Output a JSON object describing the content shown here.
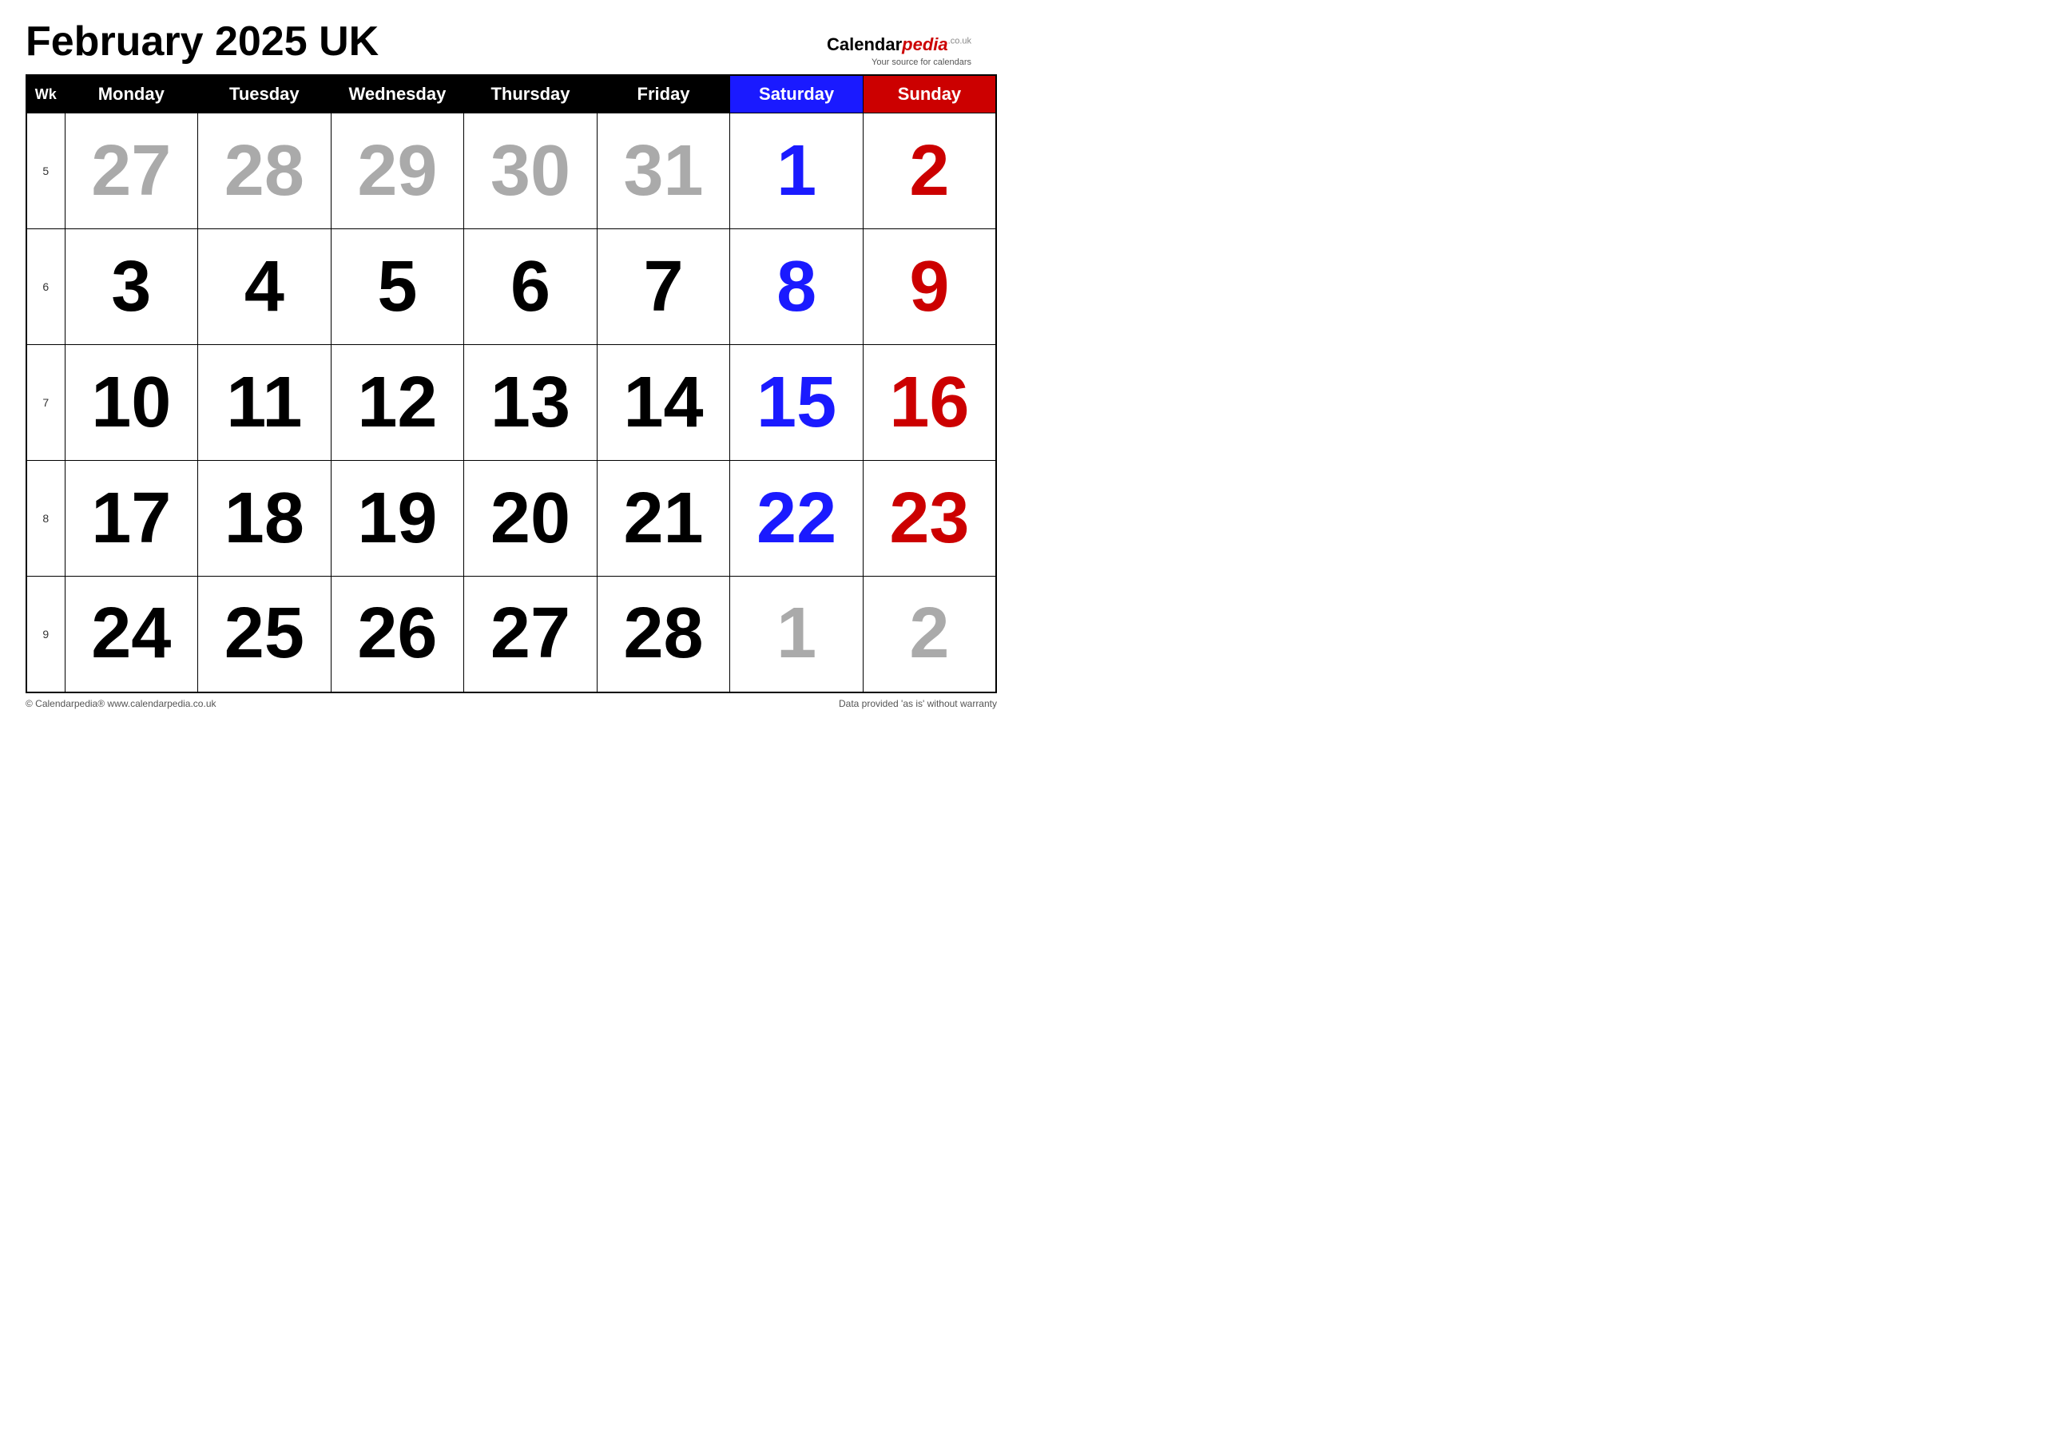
{
  "title": "February 2025 UK",
  "logo": {
    "brand": "Calendar",
    "brand_italic": "pedia",
    "co_uk": ".co.uk",
    "tagline": "Your source for calendars"
  },
  "headers": {
    "wk": "Wk",
    "monday": "Monday",
    "tuesday": "Tuesday",
    "wednesday": "Wednesday",
    "thursday": "Thursday",
    "friday": "Friday",
    "saturday": "Saturday",
    "sunday": "Sunday"
  },
  "weeks": [
    {
      "wk": "5",
      "days": [
        {
          "num": "27",
          "color": "gray"
        },
        {
          "num": "28",
          "color": "gray"
        },
        {
          "num": "29",
          "color": "gray"
        },
        {
          "num": "30",
          "color": "gray"
        },
        {
          "num": "31",
          "color": "gray"
        },
        {
          "num": "1",
          "color": "blue"
        },
        {
          "num": "2",
          "color": "red"
        }
      ]
    },
    {
      "wk": "6",
      "days": [
        {
          "num": "3",
          "color": "black"
        },
        {
          "num": "4",
          "color": "black"
        },
        {
          "num": "5",
          "color": "black"
        },
        {
          "num": "6",
          "color": "black"
        },
        {
          "num": "7",
          "color": "black"
        },
        {
          "num": "8",
          "color": "blue"
        },
        {
          "num": "9",
          "color": "red"
        }
      ]
    },
    {
      "wk": "7",
      "days": [
        {
          "num": "10",
          "color": "black"
        },
        {
          "num": "11",
          "color": "black"
        },
        {
          "num": "12",
          "color": "black"
        },
        {
          "num": "13",
          "color": "black"
        },
        {
          "num": "14",
          "color": "black"
        },
        {
          "num": "15",
          "color": "blue"
        },
        {
          "num": "16",
          "color": "red"
        }
      ]
    },
    {
      "wk": "8",
      "days": [
        {
          "num": "17",
          "color": "black"
        },
        {
          "num": "18",
          "color": "black"
        },
        {
          "num": "19",
          "color": "black"
        },
        {
          "num": "20",
          "color": "black"
        },
        {
          "num": "21",
          "color": "black"
        },
        {
          "num": "22",
          "color": "blue"
        },
        {
          "num": "23",
          "color": "red"
        }
      ]
    },
    {
      "wk": "9",
      "days": [
        {
          "num": "24",
          "color": "black"
        },
        {
          "num": "25",
          "color": "black"
        },
        {
          "num": "26",
          "color": "black"
        },
        {
          "num": "27",
          "color": "black"
        },
        {
          "num": "28",
          "color": "black"
        },
        {
          "num": "1",
          "color": "gray"
        },
        {
          "num": "2",
          "color": "gray"
        }
      ]
    }
  ],
  "footer": {
    "left": "© Calendarpedia®  www.calendarpedia.co.uk",
    "right": "Data provided 'as is' without warranty"
  }
}
